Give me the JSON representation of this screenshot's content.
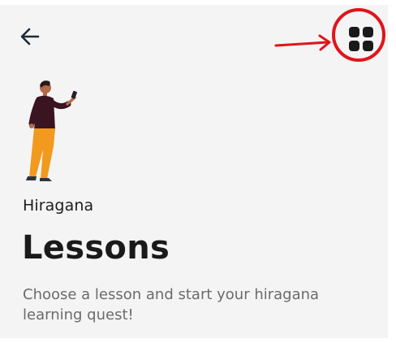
{
  "header": {
    "back_icon": "arrow-left-icon",
    "menu_icon": "grid-icon",
    "annotation_color": "#e0141c"
  },
  "illustration": {
    "icon": "person-holding-phone-illustration",
    "colors": {
      "shirt": "#3a1420",
      "pants": "#f29a1e",
      "skin": "#b26a4a"
    }
  },
  "content": {
    "subtitle": "Hiragana",
    "title": "Lessons",
    "description": "Choose a lesson and start your hiragana learning quest!"
  }
}
